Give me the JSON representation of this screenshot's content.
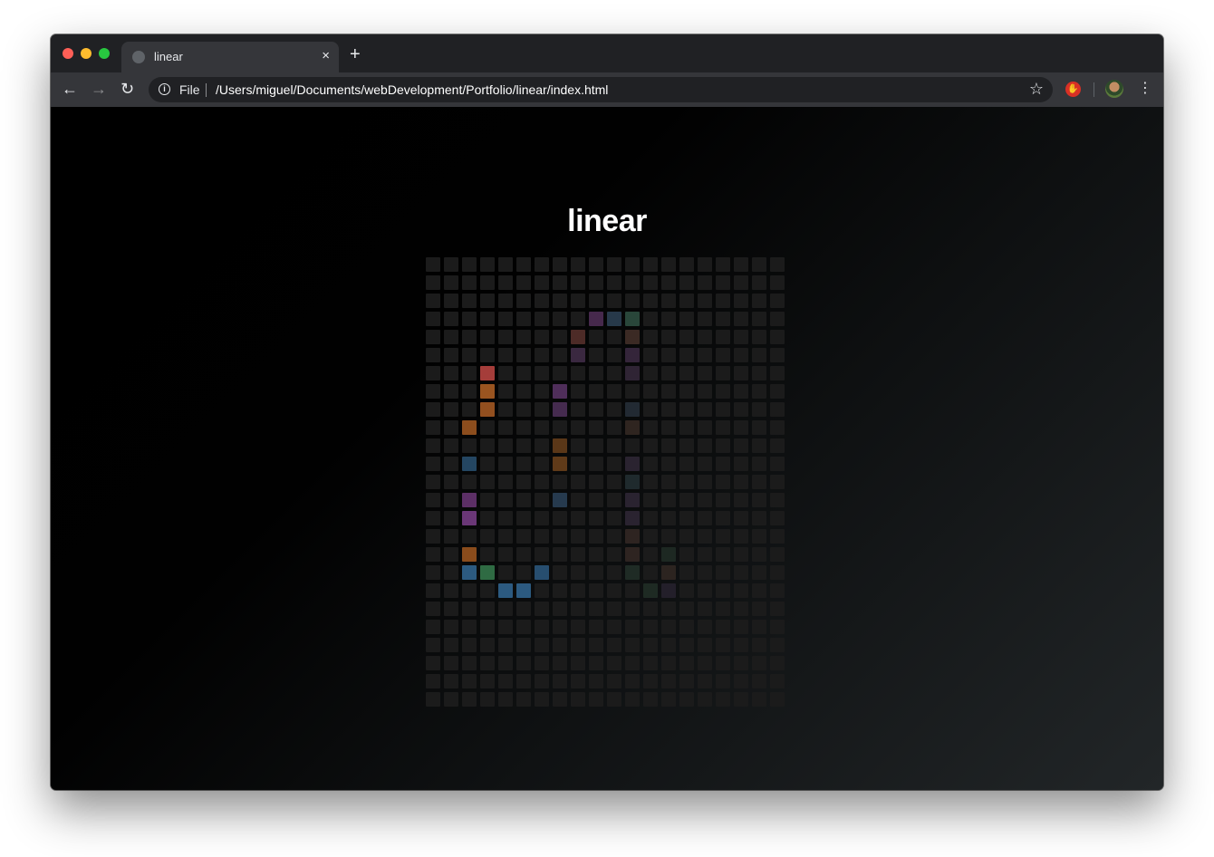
{
  "browser": {
    "tab_title": "linear",
    "tab_close": "×",
    "new_tab": "+",
    "back": "←",
    "forward": "→",
    "reload": "↻",
    "info": "i",
    "origin": "File",
    "url": "/Users/miguel/Documents/webDevelopment/Portfolio/linear/index.html",
    "star": "☆",
    "menu": "⋮"
  },
  "page": {
    "title": "linear"
  },
  "grid": {
    "columns": 20,
    "rows": 25,
    "empty_color": "#1b1b1b",
    "lit_cells": [
      {
        "col": 9,
        "row": 3,
        "color": "#46294c"
      },
      {
        "col": 10,
        "row": 3,
        "color": "#27394a"
      },
      {
        "col": 11,
        "row": 3,
        "color": "#29463a"
      },
      {
        "col": 8,
        "row": 4,
        "color": "#4d2b27"
      },
      {
        "col": 11,
        "row": 4,
        "color": "#3b2a24"
      },
      {
        "col": 8,
        "row": 5,
        "color": "#3a2840"
      },
      {
        "col": 11,
        "row": 5,
        "color": "#34253a"
      },
      {
        "col": 3,
        "row": 6,
        "color": "#a53d3a"
      },
      {
        "col": 11,
        "row": 6,
        "color": "#2f2434"
      },
      {
        "col": 3,
        "row": 7,
        "color": "#9a5420"
      },
      {
        "col": 7,
        "row": 7,
        "color": "#4f2e5a"
      },
      {
        "col": 3,
        "row": 8,
        "color": "#924f1f"
      },
      {
        "col": 7,
        "row": 8,
        "color": "#452b4f"
      },
      {
        "col": 11,
        "row": 8,
        "color": "#222a33"
      },
      {
        "col": 2,
        "row": 9,
        "color": "#8c4d1d"
      },
      {
        "col": 11,
        "row": 9,
        "color": "#2f2520"
      },
      {
        "col": 7,
        "row": 10,
        "color": "#5a3718"
      },
      {
        "col": 7,
        "row": 11,
        "color": "#5f3a19"
      },
      {
        "col": 2,
        "row": 11,
        "color": "#244662"
      },
      {
        "col": 11,
        "row": 11,
        "color": "#2a2330"
      },
      {
        "col": 11,
        "row": 12,
        "color": "#1f2a2d"
      },
      {
        "col": 2,
        "row": 13,
        "color": "#5c2f66"
      },
      {
        "col": 7,
        "row": 13,
        "color": "#263a4e"
      },
      {
        "col": 11,
        "row": 13,
        "color": "#2a2330"
      },
      {
        "col": 2,
        "row": 14,
        "color": "#6a3777"
      },
      {
        "col": 11,
        "row": 14,
        "color": "#2a2330"
      },
      {
        "col": 11,
        "row": 15,
        "color": "#2e2421"
      },
      {
        "col": 2,
        "row": 16,
        "color": "#8a4c1c"
      },
      {
        "col": 11,
        "row": 16,
        "color": "#2e2421"
      },
      {
        "col": 13,
        "row": 16,
        "color": "#1d2822"
      },
      {
        "col": 2,
        "row": 17,
        "color": "#2c5a80"
      },
      {
        "col": 3,
        "row": 17,
        "color": "#2f6b43"
      },
      {
        "col": 6,
        "row": 17,
        "color": "#274e6f"
      },
      {
        "col": 11,
        "row": 17,
        "color": "#1f2b25"
      },
      {
        "col": 13,
        "row": 17,
        "color": "#2c2420"
      },
      {
        "col": 4,
        "row": 18,
        "color": "#2c5a80"
      },
      {
        "col": 5,
        "row": 18,
        "color": "#2c5a80"
      },
      {
        "col": 12,
        "row": 18,
        "color": "#1e2a23"
      },
      {
        "col": 13,
        "row": 18,
        "color": "#231f2a"
      }
    ]
  }
}
